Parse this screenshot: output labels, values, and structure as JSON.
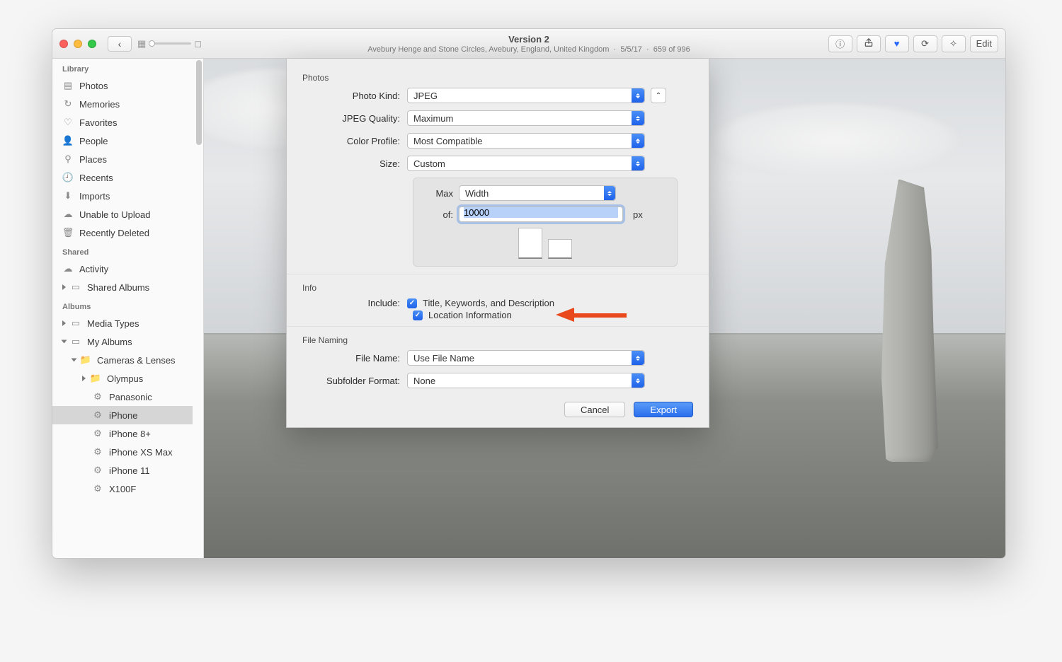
{
  "title": {
    "main": "Version 2",
    "location": "Avebury Henge and Stone Circles, Avebury, England, United Kingdom",
    "date": "5/5/17",
    "counter": "659 of 996"
  },
  "toolbar": {
    "edit": "Edit"
  },
  "sidebar": {
    "library_title": "Library",
    "library": [
      "Photos",
      "Memories",
      "Favorites",
      "People",
      "Places",
      "Recents",
      "Imports",
      "Unable to Upload",
      "Recently Deleted"
    ],
    "shared_title": "Shared",
    "shared": [
      "Activity",
      "Shared Albums"
    ],
    "albums_title": "Albums",
    "media_types": "Media Types",
    "my_albums": "My Albums",
    "cameras": "Cameras & Lenses",
    "olympus": "Olympus",
    "devices": [
      "Panasonic",
      "iPhone",
      "iPhone 8+",
      "iPhone XS Max",
      "iPhone 11",
      "X100F"
    ]
  },
  "dialog": {
    "section_photos": "Photos",
    "photo_kind_label": "Photo Kind:",
    "photo_kind": "JPEG",
    "jpeg_quality_label": "JPEG Quality:",
    "jpeg_quality": "Maximum",
    "color_profile_label": "Color Profile:",
    "color_profile": "Most Compatible",
    "size_label": "Size:",
    "size": "Custom",
    "max_label": "Max",
    "max_dim": "Width",
    "of_label": "of:",
    "of_value": "10000",
    "px_label": "px",
    "section_info": "Info",
    "include_label": "Include:",
    "include_tkd": "Title, Keywords, and Description",
    "include_loc": "Location Information",
    "section_filenaming": "File Naming",
    "filename_label": "File Name:",
    "filename": "Use File Name",
    "subfolder_label": "Subfolder Format:",
    "subfolder": "None",
    "cancel": "Cancel",
    "export": "Export"
  }
}
